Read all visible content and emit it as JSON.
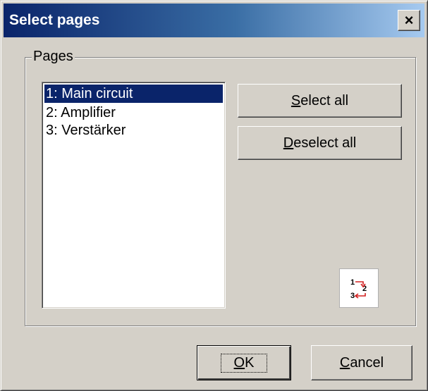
{
  "dialog": {
    "title": "Select pages",
    "close_label": "×"
  },
  "pages_group": {
    "legend": "Pages",
    "items": [
      {
        "label": "1: Main circuit",
        "selected": true
      },
      {
        "label": "2: Amplifier",
        "selected": false
      },
      {
        "label": "3: Verstärker",
        "selected": false
      }
    ]
  },
  "buttons": {
    "select_all": {
      "accel": "S",
      "rest": "elect all"
    },
    "deselect_all": {
      "accel": "D",
      "rest": "eselect all"
    },
    "ok": {
      "accel": "O",
      "rest": "K"
    },
    "cancel": {
      "accel": "C",
      "rest": "ancel"
    }
  },
  "page_order_icon": {
    "icon": "page-order-icon",
    "digits": [
      "1",
      "2",
      "3"
    ],
    "arrow_color": "#d42020"
  },
  "colors": {
    "title_gradient_start": "#0a246a",
    "title_gradient_end": "#a6caf0",
    "selection": "#0a246a",
    "face": "#d4d0c8"
  }
}
